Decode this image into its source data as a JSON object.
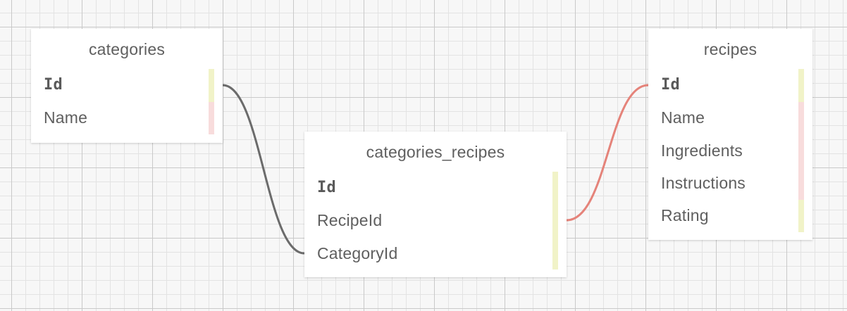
{
  "diagram": {
    "tables": [
      {
        "name": "categories",
        "fields": [
          "Id",
          "Name"
        ],
        "primary_key": "Id"
      },
      {
        "name": "categories_recipes",
        "fields": [
          "Id",
          "RecipeId",
          "CategoryId"
        ],
        "primary_key": "Id"
      },
      {
        "name": "recipes",
        "fields": [
          "Id",
          "Name",
          "Ingredients",
          "Instructions",
          "Rating"
        ],
        "primary_key": "Id"
      }
    ],
    "relationships": [
      {
        "from": "categories.Id",
        "to": "categories_recipes.CategoryId",
        "color": "#6b6b6b"
      },
      {
        "from": "categories_recipes.RecipeId",
        "to": "recipes.Id",
        "color": "#e5837a"
      }
    ],
    "colors": {
      "key_marker": "#f1f3c8",
      "field_marker": "#f8dcdc",
      "background": "#f7f7f7",
      "grid_major": "#c9c9c9",
      "grid_minor": "#e3e3e3"
    }
  }
}
